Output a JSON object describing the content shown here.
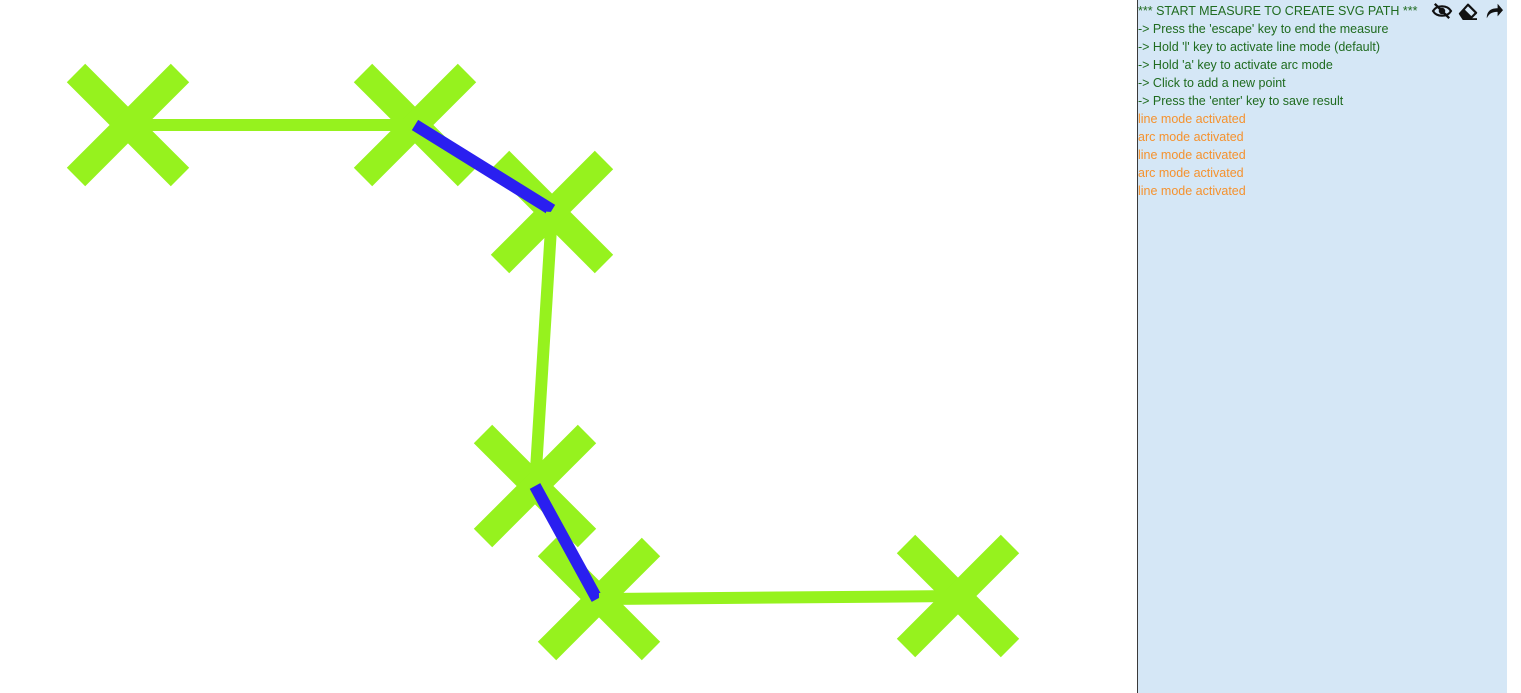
{
  "colors": {
    "marker": "#96f21e",
    "line_segment": "#96f21e",
    "arc_segment": "#2a1ff0",
    "panel_bg": "#d5e7f6",
    "info_text": "#1f6b1f",
    "mode_text": "#f5922e"
  },
  "toolbar": {
    "hide_icon": "eye-slash-icon",
    "erase_icon": "eraser-icon",
    "redo_icon": "redo-arrow-icon"
  },
  "log": [
    {
      "text": "*** START MEASURE TO CREATE SVG PATH ***",
      "kind": "info"
    },
    {
      "text": "-> Press the 'escape' key to end the measure",
      "kind": "info"
    },
    {
      "text": "-> Hold 'l' key to activate line mode (default)",
      "kind": "info"
    },
    {
      "text": "-> Hold 'a' key to activate arc mode",
      "kind": "info"
    },
    {
      "text": "-> Click to add a new point",
      "kind": "info"
    },
    {
      "text": "-> Press the 'enter' key to save result",
      "kind": "info"
    },
    {
      "text": "line mode activated",
      "kind": "mode"
    },
    {
      "text": "arc mode activated",
      "kind": "mode"
    },
    {
      "text": "line mode activated",
      "kind": "mode"
    },
    {
      "text": "arc mode activated",
      "kind": "mode"
    },
    {
      "text": "line mode activated",
      "kind": "mode"
    }
  ]
}
